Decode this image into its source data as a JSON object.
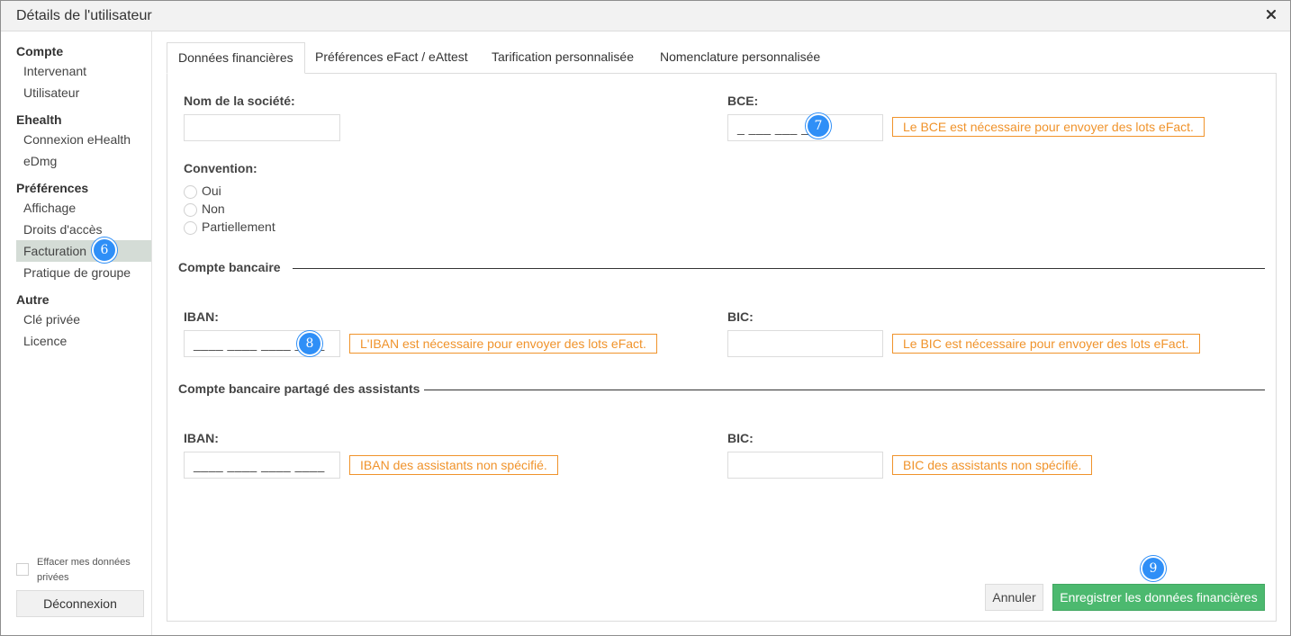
{
  "window": {
    "title": "Détails de l'utilisateur",
    "close_icon": "close-icon"
  },
  "sidebar": {
    "groups": [
      {
        "label": "Compte",
        "items": [
          "Intervenant",
          "Utilisateur"
        ]
      },
      {
        "label": "Ehealth",
        "items": [
          "Connexion eHealth",
          "eDmg"
        ]
      },
      {
        "label": "Préférences",
        "items": [
          "Affichage",
          "Droits d'accès",
          "Facturation",
          "Pratique de groupe"
        ]
      },
      {
        "label": "Autre",
        "items": [
          "Clé privée",
          "Licence"
        ]
      }
    ],
    "active_item": "Facturation",
    "clear_data_label": "Effacer mes données privées",
    "logout_label": "Déconnexion"
  },
  "tabs": [
    "Données financières",
    "Préférences eFact / eAttest",
    "Tarification personnalisée",
    "Nomenclature personnalisée"
  ],
  "active_tab": "Données financières",
  "form": {
    "company_label": "Nom de la société:",
    "company_value": "",
    "bce_label": "BCE:",
    "bce_value": "_ ___ ___ ___",
    "bce_warning": "Le BCE est nécessaire pour envoyer des lots eFact.",
    "convention_label": "Convention:",
    "convention_options": [
      "Oui",
      "Non",
      "Partiellement"
    ],
    "bank_section": "Compte bancaire",
    "iban_label": "IBAN:",
    "iban_value": "____ ____ ____ ____",
    "iban_warning": "L'IBAN est nécessaire pour envoyer des lots eFact.",
    "bic_label": "BIC:",
    "bic_value": "",
    "bic_warning": "Le BIC est nécessaire pour envoyer des lots eFact.",
    "shared_section": "Compte bancaire partagé des assistants",
    "shared_iban_label": "IBAN:",
    "shared_iban_value": "____ ____ ____ ____",
    "shared_iban_warning": "IBAN des assistants non spécifié.",
    "shared_bic_label": "BIC:",
    "shared_bic_value": "",
    "shared_bic_warning": "BIC des assistants non spécifié."
  },
  "buttons": {
    "cancel": "Annuler",
    "save": "Enregistrer les données financières"
  },
  "badges": [
    "6",
    "7",
    "8",
    "9"
  ],
  "colors": {
    "badge": "#2f8ff7",
    "warning": "#f0932b",
    "save": "#4cb96f",
    "active_sidebar": "#d4dcd6"
  }
}
